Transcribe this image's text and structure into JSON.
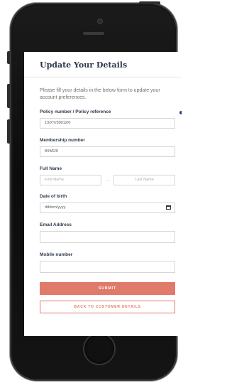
{
  "page": {
    "title": "Update Your Details",
    "intro": "Please fill your details in the below form to update your account preferences."
  },
  "form": {
    "policy": {
      "label": "Policy number / Policy reference",
      "value": "13/XY/30012/0"
    },
    "membership": {
      "label": "Membership number",
      "value": "844/E/0"
    },
    "full_name": {
      "label": "Full Name",
      "first_placeholder": "First Name",
      "last_placeholder": "Last Name"
    },
    "dob": {
      "label": "Date of birth",
      "placeholder": "dd/mm/yyyy"
    },
    "email": {
      "label": "Email Address",
      "value": ""
    },
    "mobile": {
      "label": "Mobile number",
      "value": ""
    }
  },
  "actions": {
    "submit_label": "SUBMIT",
    "back_label": "BACK TO CUSTOMER DETAILS"
  },
  "colors": {
    "accent": "#e07a6a",
    "heading": "#2e3a4b",
    "indicator": "#1a3a9e"
  }
}
